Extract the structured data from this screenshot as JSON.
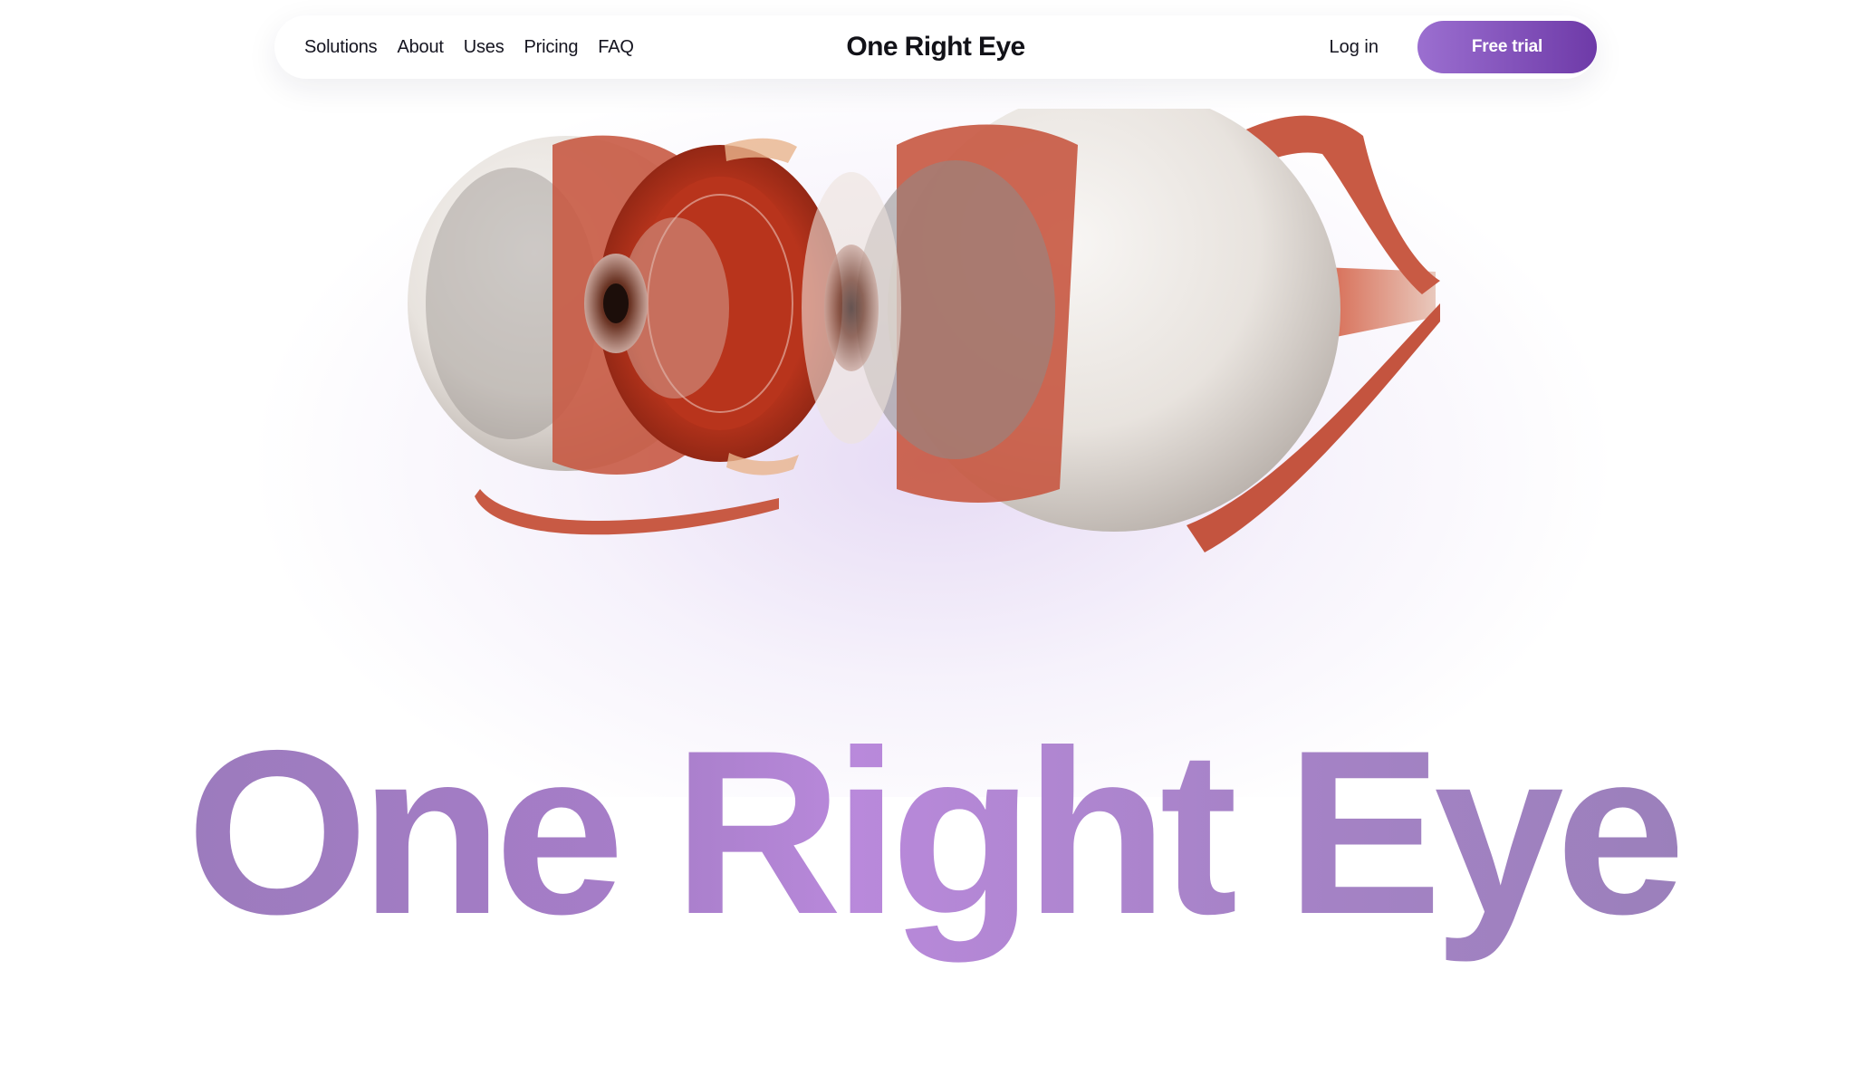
{
  "nav": {
    "links": [
      "Solutions",
      "About",
      "Uses",
      "Pricing",
      "FAQ"
    ],
    "brand": "One Right Eye",
    "login": "Log in",
    "cta": "Free trial"
  },
  "hero": {
    "title": "One Right Eye",
    "image_icon": "eye-anatomy-illustration"
  },
  "colors": {
    "accent": "#8a5bc0",
    "button_start": "#9b6fd0",
    "button_end": "#6e3aa8",
    "title": "#a27dc2",
    "muscle": "#c85a44",
    "sclera": "#ece8e4"
  }
}
